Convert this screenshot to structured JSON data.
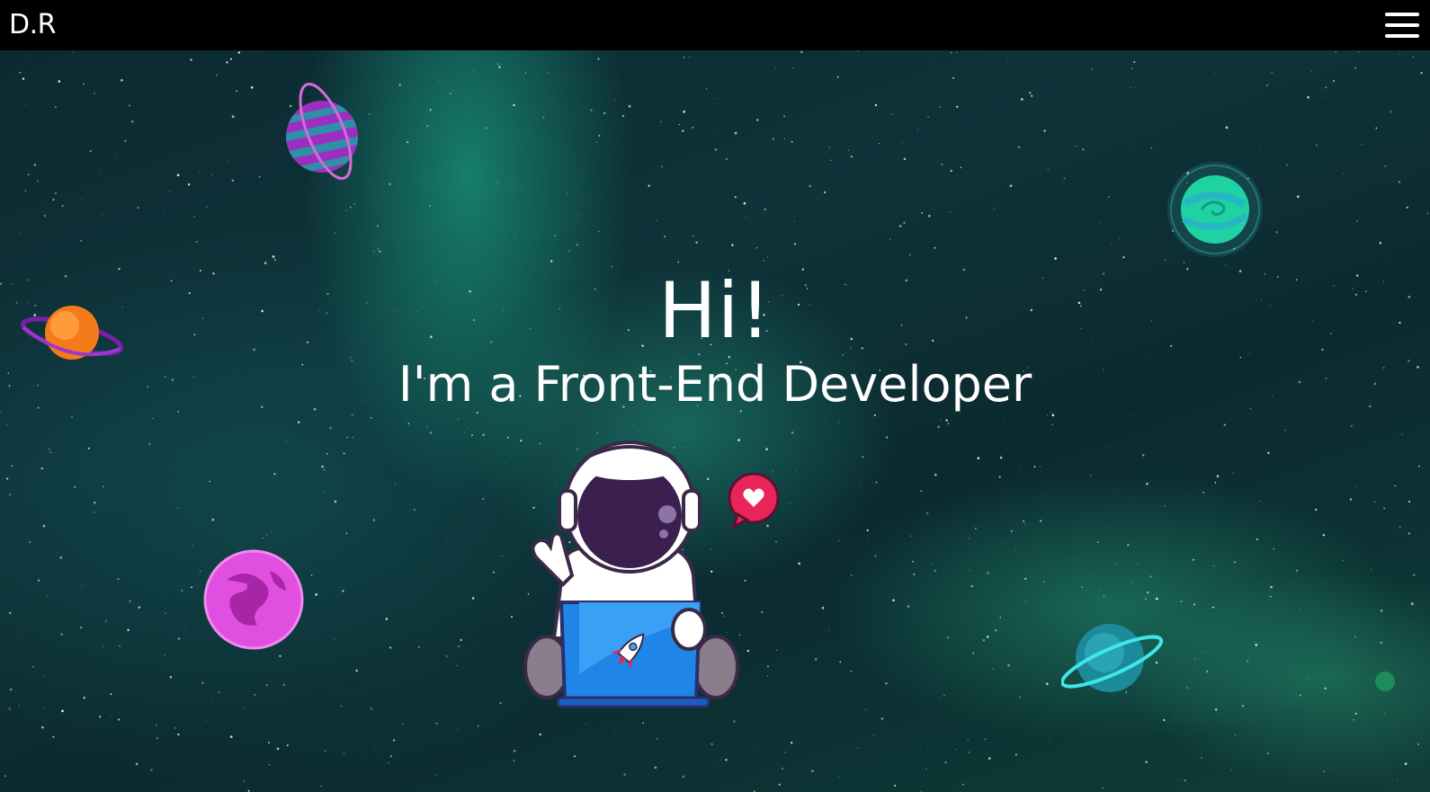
{
  "navbar": {
    "logo": "D.R",
    "menu_icon": "hamburger-menu-icon"
  },
  "hero": {
    "title": "Hi!",
    "subtitle": "I'm a Front-End Developer",
    "illustration": "astronaut-with-laptop",
    "decorations": [
      "striped-purple-planet",
      "green-swirl-planet",
      "orange-ringed-planet",
      "pink-planet",
      "teal-ringed-planet",
      "heart-speech-bubble-icon",
      "rocket-icon"
    ]
  },
  "colors": {
    "navbar_bg": "#000000",
    "text": "#ffffff",
    "space_bg": "#0e3339",
    "nebula": "#1ebe96"
  }
}
